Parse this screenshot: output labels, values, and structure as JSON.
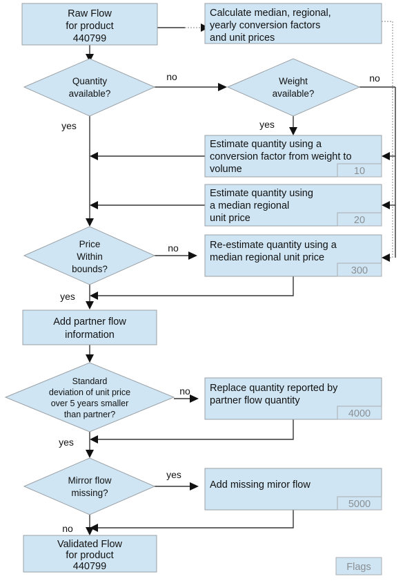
{
  "diagram": {
    "title": "Trade flow validation flowchart",
    "colors": {
      "node_fill": "#cfe5f3",
      "node_stroke": "#9aa0a6",
      "line": "#333333",
      "dotted_line": "#999999",
      "badge_text": "#8a8f94",
      "text": "#111111"
    },
    "nodes": {
      "raw_flow": {
        "shape": "process",
        "lines": [
          "Raw  Flow",
          "for product",
          "440799"
        ]
      },
      "calculate_factors": {
        "shape": "process",
        "lines": [
          "Calculate median, regional,",
          "yearly conversion factors",
          "and unit prices"
        ]
      },
      "quantity_available": {
        "shape": "decision",
        "lines": [
          "Quantity",
          "available?"
        ]
      },
      "weight_available": {
        "shape": "decision",
        "lines": [
          "Weight",
          "available?"
        ]
      },
      "estimate_conversion": {
        "shape": "process",
        "lines": [
          "Estimate quantity using a",
          "conversion factor from weight to",
          "volume"
        ],
        "flag": "10"
      },
      "estimate_median": {
        "shape": "process",
        "lines": [
          "Estimate quantity using",
          "a median regional",
          "unit price"
        ],
        "flag": "20"
      },
      "price_within_bounds": {
        "shape": "decision",
        "lines": [
          "Price",
          "Within",
          "bounds?"
        ]
      },
      "reestimate_quantity": {
        "shape": "process",
        "lines": [
          "Re-estimate quantity using a",
          "median regional unit price"
        ],
        "flag": "300"
      },
      "add_partner_flow": {
        "shape": "process",
        "lines": [
          "Add partner flow",
          "information"
        ]
      },
      "std_deviation": {
        "shape": "decision",
        "lines": [
          "Standard",
          "deviation of unit price",
          "over 5 years smaller",
          "than partner?"
        ]
      },
      "replace_quantity": {
        "shape": "process",
        "lines": [
          "Replace quantity reported by",
          "partner flow quantity"
        ],
        "flag": "4000"
      },
      "mirror_flow_missing": {
        "shape": "decision",
        "lines": [
          "Mirror flow",
          "missing?"
        ]
      },
      "add_mirror_flow": {
        "shape": "process",
        "lines": [
          "Add missing miror flow"
        ],
        "flag": "5000"
      },
      "validated_flow": {
        "shape": "process",
        "lines": [
          "Validated  Flow",
          "for product",
          "440799"
        ]
      }
    },
    "edge_labels": {
      "quantity_no": "no",
      "quantity_yes": "yes",
      "weight_no": "no",
      "weight_yes": "yes",
      "price_no": "no",
      "price_yes": "yes",
      "std_no": "no",
      "std_yes": "yes",
      "mirror_yes": "yes",
      "mirror_no": "no"
    },
    "legend": {
      "flags_label": "Flags"
    }
  }
}
